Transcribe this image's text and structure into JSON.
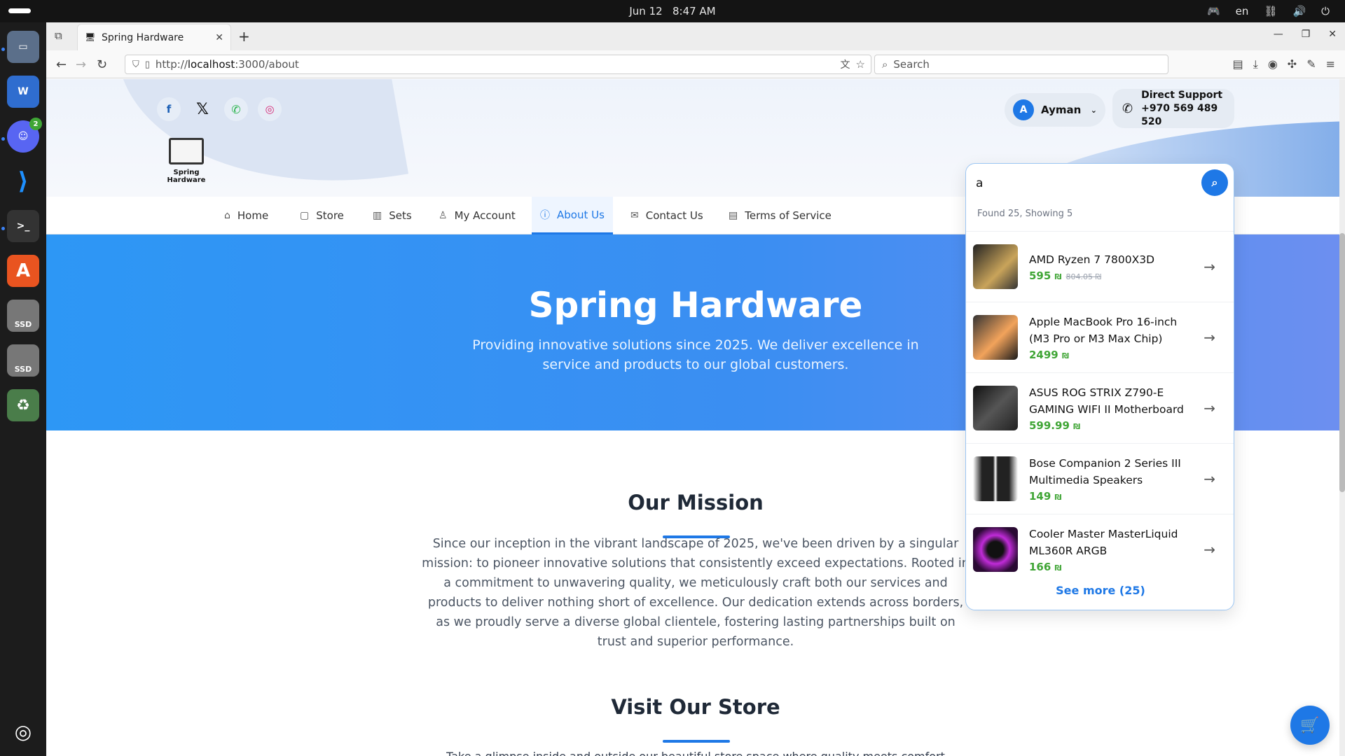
{
  "system": {
    "date": "Jun 12",
    "time": "8:47 AM",
    "lang": "en"
  },
  "dock": {
    "discord_badge": "2",
    "ssd1": "SSD",
    "ssd2": "SSD"
  },
  "browser": {
    "tab_title": "Spring Hardware",
    "url_prefix": "http://",
    "url_host": "localhost",
    "url_path": ":3000/about",
    "search_placeholder": "Search"
  },
  "header": {
    "logo_text": "Spring Hardware",
    "user_initial": "A",
    "user_name": "Ayman",
    "support_label": "Direct Support",
    "support_phone": "+970 569 489 520"
  },
  "nav": {
    "items": [
      {
        "label": "Home",
        "icon": "home-icon"
      },
      {
        "label": "Store",
        "icon": "bag-icon"
      },
      {
        "label": "Sets",
        "icon": "building-icon"
      },
      {
        "label": "My Account",
        "icon": "user-icon"
      },
      {
        "label": "About Us",
        "icon": "info-icon",
        "active": true
      },
      {
        "label": "Contact Us",
        "icon": "mail-icon"
      },
      {
        "label": "Terms of Service",
        "icon": "document-icon"
      }
    ]
  },
  "hero": {
    "title": "Spring Hardware",
    "subtitle": "Providing innovative solutions since 2025. We deliver excellence in service and products to our global customers."
  },
  "mission": {
    "heading": "Our Mission",
    "body": "Since our inception in the vibrant landscape of 2025, we've been driven by a singular mission: to pioneer innovative solutions that consistently exceed expectations. Rooted in a commitment to unwavering quality, we meticulously craft both our services and products to deliver nothing short of excellence. Our dedication extends across borders, as we proudly serve a diverse global clientele, fostering lasting partnerships built on trust and superior performance."
  },
  "store": {
    "heading": "Visit Our Store",
    "body": "Take a glimpse inside and outside our beautiful store space where quality meets comfort"
  },
  "search": {
    "query": "a",
    "found": "Found 25, Showing 5",
    "results": [
      {
        "name": "AMD Ryzen 7 7800X3D",
        "price": "595",
        "old_price": "804.05",
        "currency": "₪"
      },
      {
        "name": "Apple MacBook Pro 16-inch (M3 Pro or M3 Max Chip)",
        "price": "2499",
        "currency": "₪"
      },
      {
        "name": "ASUS ROG STRIX Z790-E GAMING WIFI II Motherboard",
        "price": "599.99",
        "currency": "₪"
      },
      {
        "name": "Bose Companion 2 Series III Multimedia Speakers",
        "price": "149",
        "currency": "₪"
      },
      {
        "name": "Cooler Master MasterLiquid ML360R ARGB",
        "price": "166",
        "currency": "₪"
      }
    ],
    "see_more": "See more (25)"
  },
  "colors": {
    "accent": "#1e78e6",
    "price_green": "#3fa535",
    "hero_start": "#2d97f5"
  }
}
